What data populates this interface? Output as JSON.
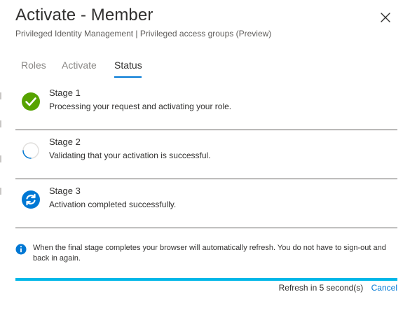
{
  "header": {
    "title": "Activate - Member",
    "subtitle": "Privileged Identity Management | Privileged access groups (Preview)"
  },
  "tabs": [
    {
      "label": "Roles",
      "active": false
    },
    {
      "label": "Activate",
      "active": false
    },
    {
      "label": "Status",
      "active": true
    }
  ],
  "stages": [
    {
      "title": "Stage 1",
      "description": "Processing your request and activating your role.",
      "state": "completed",
      "icon": "check-circle-icon"
    },
    {
      "title": "Stage 2",
      "description": "Validating that your activation is successful.",
      "state": "in-progress",
      "icon": "spinner-icon"
    },
    {
      "title": "Stage 3",
      "description": "Activation completed successfully.",
      "state": "pending",
      "icon": "refresh-circle-icon"
    }
  ],
  "info": {
    "text": "When the final stage completes your browser will automatically refresh. You do not have to sign-out and back in again.",
    "icon": "info-icon"
  },
  "progress": {
    "percent": 100
  },
  "footer": {
    "refresh_text": "Refresh in 5 second(s)",
    "cancel_label": "Cancel"
  },
  "colors": {
    "accent": "#0078d4",
    "success": "#57a300",
    "progress": "#00b7e8",
    "text": "#323130",
    "muted": "#8a8886"
  }
}
